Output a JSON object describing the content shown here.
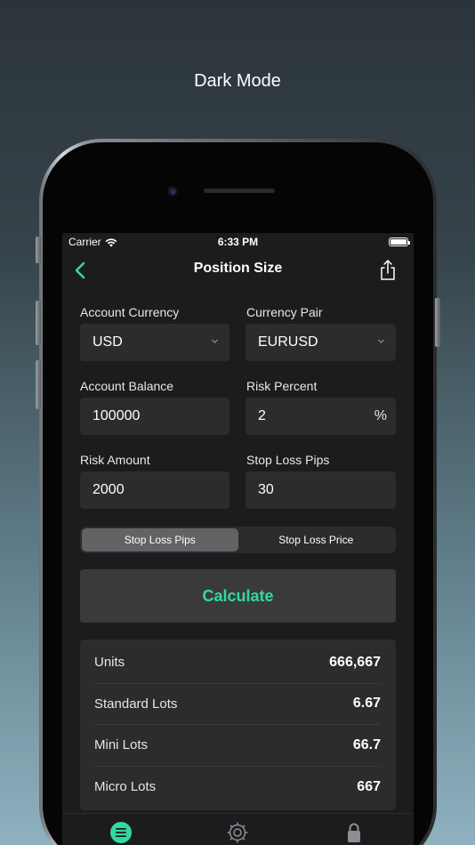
{
  "promo": {
    "title": "Dark Mode"
  },
  "status_bar": {
    "carrier": "Carrier",
    "time": "6:33 PM"
  },
  "nav": {
    "title": "Position Size",
    "back_icon": "chevron-left-icon",
    "share_icon": "share-icon"
  },
  "form": {
    "account_currency": {
      "label": "Account Currency",
      "value": "USD"
    },
    "currency_pair": {
      "label": "Currency Pair",
      "value": "EURUSD"
    },
    "account_balance": {
      "label": "Account Balance",
      "value": "100000"
    },
    "risk_percent": {
      "label": "Risk Percent",
      "value": "2",
      "suffix": "%"
    },
    "risk_amount": {
      "label": "Risk Amount",
      "value": "2000"
    },
    "stop_loss_pips": {
      "label": "Stop Loss Pips",
      "value": "30"
    }
  },
  "segmented": {
    "options": [
      "Stop Loss Pips",
      "Stop Loss Price"
    ],
    "selected": "Stop Loss Pips"
  },
  "calculate_label": "Calculate",
  "results": [
    {
      "label": "Units",
      "value": "666,667"
    },
    {
      "label": "Standard Lots",
      "value": "6.67"
    },
    {
      "label": "Mini Lots",
      "value": "66.7"
    },
    {
      "label": "Micro Lots",
      "value": "667"
    }
  ],
  "tabs": [
    {
      "icon": "list-icon",
      "active": true
    },
    {
      "icon": "gear-icon",
      "active": false
    },
    {
      "icon": "lock-icon",
      "active": false
    }
  ],
  "colors": {
    "accent": "#32d8a0",
    "background": "#1c1c1e",
    "field": "#2c2c2e"
  }
}
